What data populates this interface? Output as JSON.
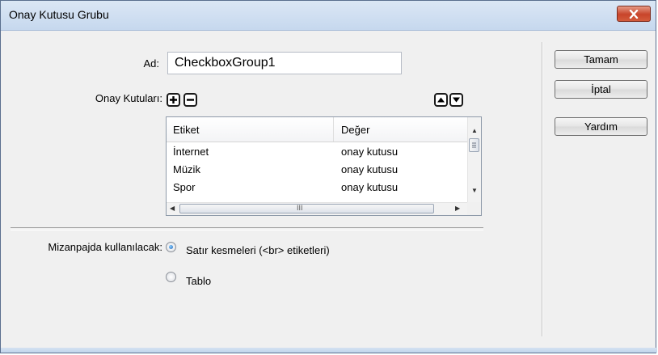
{
  "window": {
    "title": "Onay Kutusu Grubu"
  },
  "form": {
    "name_label": "Ad:",
    "name_value": "CheckboxGroup1",
    "checkboxes_label": "Onay Kutuları:"
  },
  "list": {
    "columns": [
      "Etiket",
      "Değer"
    ],
    "rows": [
      {
        "label": "İnternet",
        "value": "onay kutusu"
      },
      {
        "label": "Müzik",
        "value": "onay kutusu"
      },
      {
        "label": "Spor",
        "value": "onay kutusu"
      }
    ],
    "hscroll_grip": "III"
  },
  "layout_options": {
    "label": "Mizanpajda kullanılacak:",
    "options": [
      {
        "label": "Satır kesmeleri (<br> etiketleri)",
        "selected": true
      },
      {
        "label": "Tablo",
        "selected": false
      }
    ]
  },
  "buttons": {
    "ok": "Tamam",
    "cancel": "İptal",
    "help": "Yardım"
  },
  "icons": {
    "add": "plus-icon",
    "remove": "minus-icon",
    "move_up": "arrow-up-icon",
    "move_down": "arrow-down-icon",
    "close": "close-icon"
  },
  "colors": {
    "close_button": "#c8442a",
    "radio_selected": "#1c63b8"
  }
}
